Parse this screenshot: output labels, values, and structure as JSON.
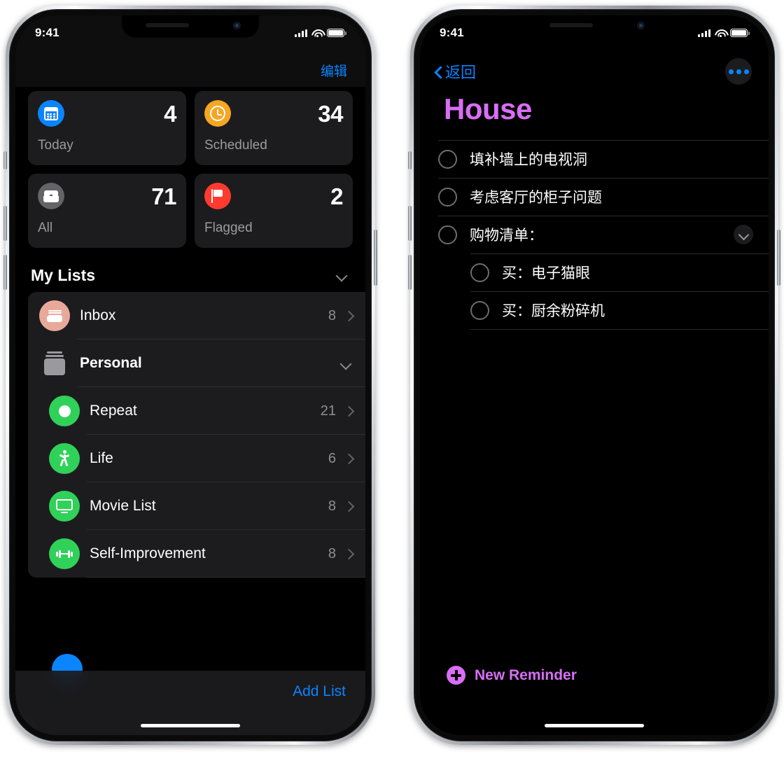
{
  "left_phone": {
    "status_bar": {
      "time": "9:41",
      "signal_icon": "cellular-signal-icon",
      "wifi_icon": "wifi-icon",
      "battery_icon": "battery-icon"
    },
    "nav": {
      "edit_label": "编辑"
    },
    "smart_cards": [
      {
        "key": "today",
        "label": "Today",
        "count": "4",
        "icon": "calendar-icon",
        "color": "#0a84ff"
      },
      {
        "key": "scheduled",
        "label": "Scheduled",
        "count": "34",
        "icon": "clock-icon",
        "color": "#f5a623"
      },
      {
        "key": "all",
        "label": "All",
        "count": "71",
        "icon": "tray-icon",
        "color": "#636368"
      },
      {
        "key": "flagged",
        "label": "Flagged",
        "count": "2",
        "icon": "flag-icon",
        "color": "#ff3b30"
      }
    ],
    "my_lists": {
      "title": "My Lists",
      "collapse_icon": "chevron-down-icon",
      "items": [
        {
          "key": "inbox",
          "name": "Inbox",
          "count": "8",
          "icon": "inbox-tray-icon",
          "color": "#e8a99a",
          "type": "list"
        },
        {
          "key": "personal",
          "name": "Personal",
          "count": "",
          "icon": "folder-group-icon",
          "color": "#9a9a9e",
          "type": "group"
        },
        {
          "key": "repeat",
          "name": "Repeat",
          "count": "21",
          "icon": "circle-icon",
          "color": "#30d158",
          "type": "list"
        },
        {
          "key": "life",
          "name": "Life",
          "count": "6",
          "icon": "walking-person-icon",
          "color": "#30d158",
          "type": "list"
        },
        {
          "key": "movie-list",
          "name": "Movie List",
          "count": "8",
          "icon": "tv-icon",
          "color": "#30d158",
          "type": "list"
        },
        {
          "key": "self-improvement",
          "name": "Self-Improvement",
          "count": "8",
          "icon": "dumbbell-icon",
          "color": "#30d158",
          "type": "list"
        }
      ]
    },
    "toolbar": {
      "add_list_label": "Add List"
    }
  },
  "right_phone": {
    "status_bar": {
      "time": "9:41",
      "signal_icon": "cellular-signal-icon",
      "wifi_icon": "wifi-icon",
      "battery_icon": "battery-icon"
    },
    "nav": {
      "back_label": "返回",
      "back_icon": "chevron-left-icon",
      "more_icon": "ellipsis-icon"
    },
    "title": "House",
    "title_color": "#d96ef5",
    "reminders": [
      {
        "key": "r1",
        "text": "填补墙上的电视洞",
        "indent": 0,
        "expandable": false,
        "expand_icon": ""
      },
      {
        "key": "r2",
        "text": "考虑客厅的柜子问题",
        "indent": 0,
        "expandable": false,
        "expand_icon": ""
      },
      {
        "key": "r3",
        "text": "购物清单：",
        "indent": 0,
        "expandable": true,
        "expand_icon": "chevron-down-icon"
      },
      {
        "key": "r4",
        "text": "买：电子猫眼",
        "indent": 1,
        "expandable": false,
        "expand_icon": ""
      },
      {
        "key": "r5",
        "text": "买：厨余粉碎机",
        "indent": 1,
        "expandable": false,
        "expand_icon": ""
      }
    ],
    "new_reminder": {
      "label": "New Reminder",
      "icon": "plus-circle-icon"
    }
  }
}
